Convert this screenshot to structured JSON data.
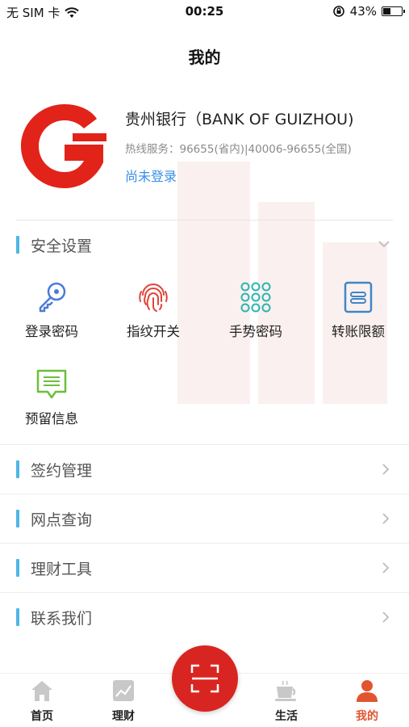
{
  "status_bar": {
    "carrier": "无 SIM 卡",
    "time": "00:25",
    "battery_percent": "43%",
    "battery_level": 0.43
  },
  "nav": {
    "title": "我的"
  },
  "bank": {
    "name": "贵州银行（BANK OF GUIZHOU)",
    "hotline": "热线服务：96655(省内)|40006-96655(全国)",
    "login_status": "尚未登录",
    "logo_color": "#e2231a"
  },
  "security": {
    "title": "安全设置",
    "items": [
      {
        "label": "登录密码",
        "icon": "key-icon"
      },
      {
        "label": "指纹开关",
        "icon": "fingerprint-icon"
      },
      {
        "label": "手势密码",
        "icon": "gesture-grid-icon"
      },
      {
        "label": "转账限额",
        "icon": "transfer-limit-icon"
      },
      {
        "label": "预留信息",
        "icon": "message-icon"
      }
    ]
  },
  "menu": [
    {
      "label": "签约管理"
    },
    {
      "label": "网点查询"
    },
    {
      "label": "理财工具"
    },
    {
      "label": "联系我们"
    }
  ],
  "tabs": [
    {
      "label": "首页",
      "icon": "home-icon"
    },
    {
      "label": "理财",
      "icon": "chart-icon"
    },
    {
      "label": "生活",
      "icon": "coffee-icon"
    },
    {
      "label": "我的",
      "icon": "person-icon",
      "active": true
    }
  ],
  "colors": {
    "accent_bar": "#4fb6e6",
    "brand_red": "#d92521",
    "link_blue": "#3a8ee6",
    "active_tab": "#e25430"
  }
}
